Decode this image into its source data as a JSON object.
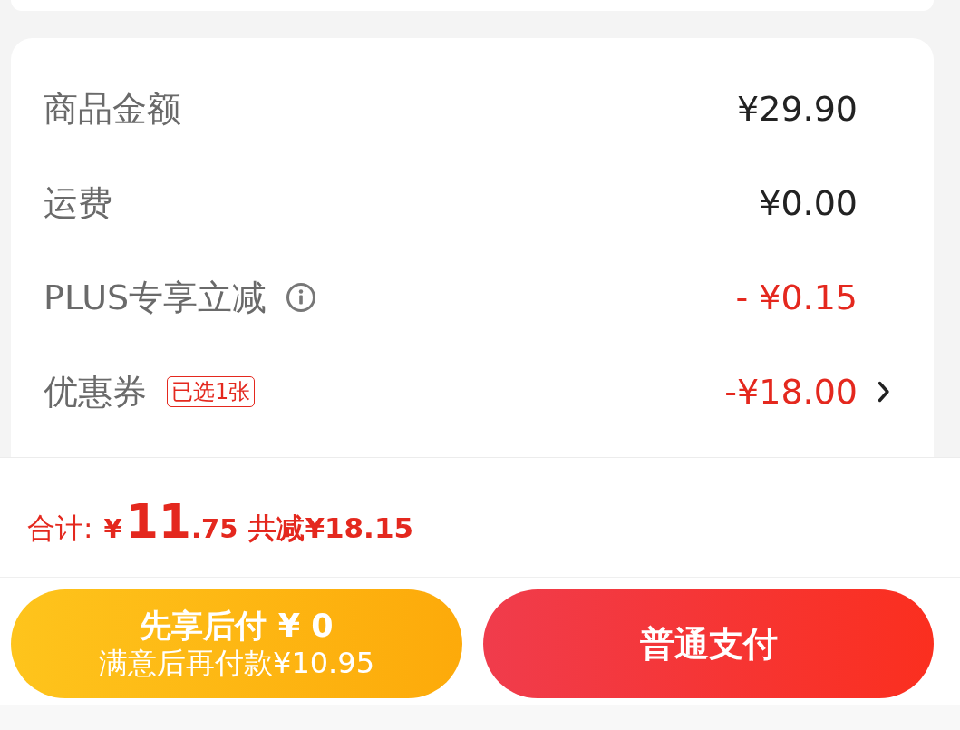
{
  "summary": {
    "rows": [
      {
        "kind": "amount",
        "label": "商品金额",
        "value": "¥29.90",
        "discount": false
      },
      {
        "kind": "amount",
        "label": "运费",
        "value": "¥0.00",
        "discount": false
      },
      {
        "kind": "info",
        "label": "PLUS专享立减",
        "value": "- ¥0.15",
        "discount": true
      },
      {
        "kind": "coupon",
        "label": "优惠券",
        "badge": "已选1张",
        "value": "-¥18.00",
        "discount": true
      }
    ]
  },
  "total": {
    "label": "合计:",
    "currency": "¥",
    "integer": "11",
    "decimal": ".75",
    "saving": "共减¥18.15"
  },
  "buttons": [
    {
      "kind": "later",
      "title": "先享后付 ¥ 0",
      "subtitle": "满意后再付款¥10.95"
    },
    {
      "kind": "normal",
      "title": "普通支付"
    }
  ]
}
